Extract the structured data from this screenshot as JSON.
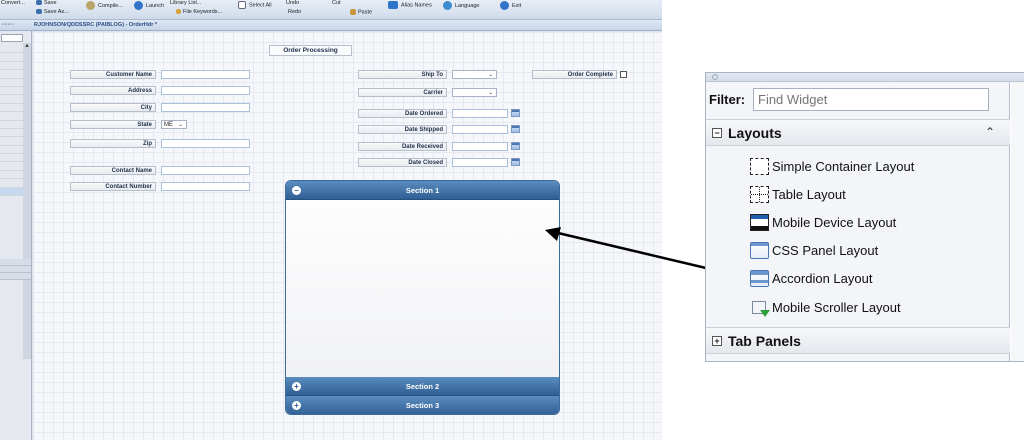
{
  "toolbar": {
    "convert": "Convert...",
    "save": "Save",
    "save_as": "Save As...",
    "compile": "Compile...",
    "launch": "Launch",
    "library_list": "Library List...",
    "file_keywords": "File Keywords...",
    "select_all": "Select All",
    "undo": "Undo",
    "redo": "Redo",
    "cut": "Cut",
    "paste": "Paste",
    "alias_names": "Alias Names",
    "language": "Language",
    "exit": "Exit"
  },
  "window": {
    "title": "RJOHNSON/QDDSSRC (PAIBLOG) - OrderHdr *"
  },
  "form": {
    "heading": "Order Processing",
    "customer_name": "Customer Name",
    "address": "Address",
    "city": "City",
    "state": "State",
    "state_value": "ME",
    "zip": "Zip",
    "contact_name": "Contact Name",
    "contact_number": "Contact Number",
    "ship_to": "Ship To",
    "carrier": "Carrier",
    "date_ordered": "Date Ordered",
    "date_shipped": "Date Shipped",
    "date_received": "Date Received",
    "date_closed": "Date Closed",
    "order_complete": "Order Complete"
  },
  "accordion": {
    "sections": [
      {
        "label": "Section 1",
        "icon": "−"
      },
      {
        "label": "Section 2",
        "icon": "+"
      },
      {
        "label": "Section 3",
        "icon": "+"
      }
    ]
  },
  "palette": {
    "filter_label": "Filter:",
    "filter_placeholder": "Find Widget",
    "layouts_toggle": "−",
    "layouts_label": "Layouts",
    "widgets": [
      {
        "label": "Simple Container Layout",
        "icon": "simple-container-icon"
      },
      {
        "label": "Table Layout",
        "icon": "table-layout-icon"
      },
      {
        "label": "Mobile Device Layout",
        "icon": "mobile-device-icon"
      },
      {
        "label": "CSS Panel Layout",
        "icon": "css-panel-icon"
      },
      {
        "label": "Accordion Layout",
        "icon": "accordion-icon"
      },
      {
        "label": "Mobile Scroller Layout",
        "icon": "mobile-scroller-icon"
      }
    ],
    "tab_panels_toggle": "+",
    "tab_panels_label": "Tab Panels"
  },
  "colors": {
    "accordion_header": "#3b6ea4",
    "arrow": "#000000"
  }
}
